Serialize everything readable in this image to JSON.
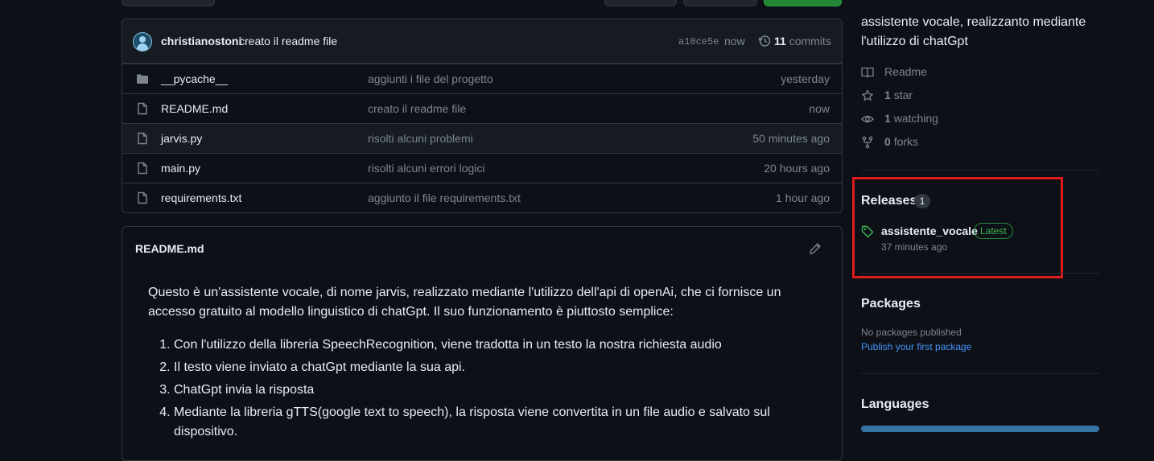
{
  "commit": {
    "author": "christianostoni",
    "message": "creato il readme file",
    "sha": "a10ce5e",
    "time": "now",
    "count": "11",
    "count_label": "commits"
  },
  "files": [
    {
      "name": "__pycache__",
      "type": "folder",
      "message": "aggiunti i file del progetto",
      "date": "yesterday"
    },
    {
      "name": "README.md",
      "type": "file",
      "message": "creato il readme file",
      "date": "now"
    },
    {
      "name": "jarvis.py",
      "type": "file",
      "message": "risolti alcuni problemi",
      "date": "50 minutes ago"
    },
    {
      "name": "main.py",
      "type": "file",
      "message": "risolti alcuni errori logici",
      "date": "20 hours ago"
    },
    {
      "name": "requirements.txt",
      "type": "file",
      "message": "aggiunto il file requirements.txt",
      "date": "1 hour ago"
    }
  ],
  "readme": {
    "title": "README.md",
    "paragraph": "Questo è un'assistente vocale, di nome jarvis, realizzato mediante l'utilizzo dell'api di openAi, che ci fornisce un accesso gratuito al modello linguistico di chatGpt. Il suo funzionamento è piuttosto semplice:",
    "steps": [
      "Con l'utilizzo della libreria SpeechRecognition, viene tradotta in un testo la nostra richiesta audio",
      "Il testo viene inviato a chatGpt mediante la sua api.",
      "ChatGpt invia la risposta",
      "Mediante la libreria gTTS(google text to speech), la risposta viene convertita in un file audio e salvato sul dispositivo."
    ]
  },
  "sidebar": {
    "about": "assistente vocale, realizzanto mediante l'utilizzo di chatGpt",
    "readme_label": "Readme",
    "stars_count": "1",
    "stars_label": "star",
    "watching_count": "1",
    "watching_label": "watching",
    "forks_count": "0",
    "forks_label": "forks",
    "releases_title": "Releases",
    "releases_count": "1",
    "release_name": "assistente_vocale",
    "release_badge": "Latest",
    "release_time": "37 minutes ago",
    "packages_title": "Packages",
    "packages_empty": "No packages published",
    "packages_link": "Publish your first package",
    "languages_title": "Languages"
  },
  "colors": {
    "background": "#0d1117",
    "border": "#30363d",
    "muted": "#7d8590",
    "link": "#4493f8",
    "latest_green": "#3fb950",
    "highlight_red": "#e01b1b",
    "python_blue": "#3572a5"
  },
  "icons": [
    "history-icon",
    "folder-icon",
    "file-icon",
    "pencil-icon",
    "book-icon",
    "star-icon",
    "eye-icon",
    "fork-icon",
    "tag-icon"
  ]
}
